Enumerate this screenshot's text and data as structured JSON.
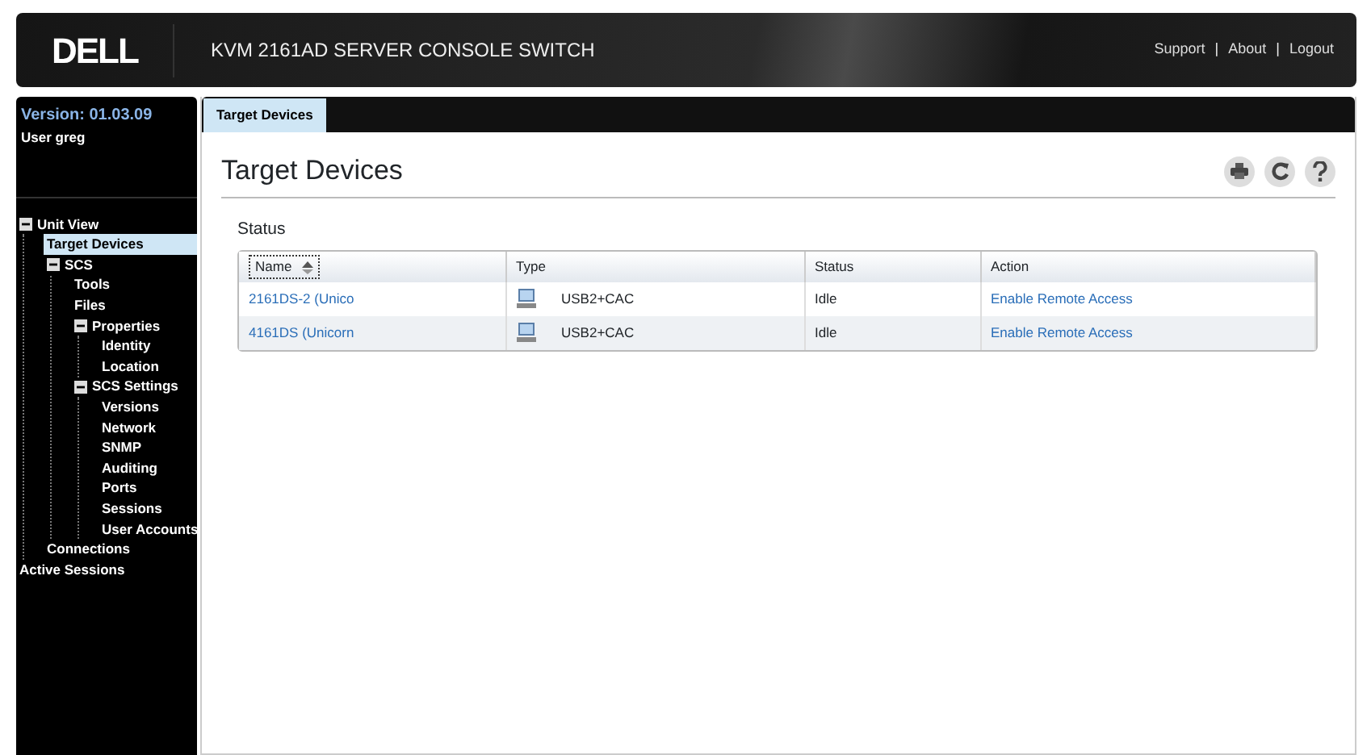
{
  "header": {
    "logo": "DELL",
    "title": "KVM 2161AD SERVER CONSOLE SWITCH",
    "links": [
      "Support",
      "About",
      "Logout"
    ],
    "separator": "|"
  },
  "sidebar": {
    "version": "Version: 01.03.09",
    "user": "User greg",
    "tree": [
      {
        "label": "Unit View",
        "expanded": true,
        "selected": false,
        "children": [
          {
            "label": "Target Devices",
            "selected": true
          },
          {
            "label": "SCS",
            "expanded": true,
            "selected": false,
            "children": [
              {
                "label": "Tools",
                "selected": false
              },
              {
                "label": "Files",
                "selected": false
              },
              {
                "label": "Properties",
                "expanded": true,
                "selected": false,
                "children": [
                  {
                    "label": "Identity",
                    "selected": false
                  },
                  {
                    "label": "Location",
                    "selected": false
                  }
                ]
              },
              {
                "label": "SCS Settings",
                "expanded": true,
                "selected": false,
                "children": [
                  {
                    "label": "Versions",
                    "selected": false
                  },
                  {
                    "label": "Network",
                    "selected": false
                  },
                  {
                    "label": "SNMP",
                    "selected": false
                  },
                  {
                    "label": "Auditing",
                    "selected": false
                  },
                  {
                    "label": "Ports",
                    "selected": false
                  },
                  {
                    "label": "Sessions",
                    "selected": false
                  },
                  {
                    "label": "User Accounts",
                    "selected": false
                  }
                ]
              }
            ]
          },
          {
            "label": "Connections",
            "selected": false
          }
        ]
      },
      {
        "label": "Active Sessions",
        "selected": false
      }
    ]
  },
  "tabs": [
    {
      "label": "Target Devices",
      "selected": true
    }
  ],
  "page": {
    "title": "Target Devices",
    "section": "Status"
  },
  "table": {
    "columns": [
      "Name",
      "Type",
      "Status",
      "Action"
    ],
    "rows": [
      {
        "name": "2161DS-2 (Unico",
        "type": "USB2+CAC",
        "status": "Idle",
        "action": "Enable Remote Access"
      },
      {
        "name": "4161DS (Unicorn",
        "type": "USB2+CAC",
        "status": "Idle",
        "action": "Enable Remote Access"
      }
    ]
  }
}
